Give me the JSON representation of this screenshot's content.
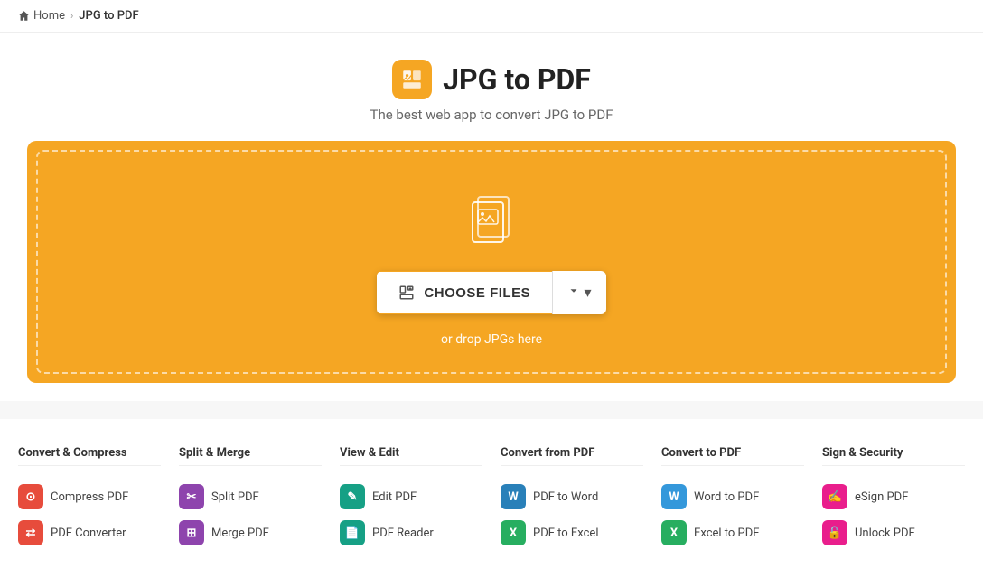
{
  "breadcrumb": {
    "home_label": "Home",
    "separator": "›",
    "current": "JPG to PDF"
  },
  "hero": {
    "title": "JPG to PDF",
    "subtitle": "The best web app to convert JPG to PDF",
    "logo_alt": "jpg-to-pdf-logo"
  },
  "dropzone": {
    "button_label": "CHOOSE FILES",
    "drop_text": "or drop JPGs here"
  },
  "tools": {
    "columns": [
      {
        "title": "Convert & Compress",
        "items": [
          {
            "label": "Compress PDF",
            "icon_color": "icon-red",
            "icon_symbol": "⊙"
          },
          {
            "label": "PDF Converter",
            "icon_color": "icon-red",
            "icon_symbol": "⇄"
          }
        ]
      },
      {
        "title": "Split & Merge",
        "items": [
          {
            "label": "Split PDF",
            "icon_color": "icon-purple",
            "icon_symbol": "✂"
          },
          {
            "label": "Merge PDF",
            "icon_color": "icon-purple",
            "icon_symbol": "⊞"
          }
        ]
      },
      {
        "title": "View & Edit",
        "items": [
          {
            "label": "Edit PDF",
            "icon_color": "icon-teal",
            "icon_symbol": "✎"
          },
          {
            "label": "PDF Reader",
            "icon_color": "icon-teal",
            "icon_symbol": "📄"
          }
        ]
      },
      {
        "title": "Convert from PDF",
        "items": [
          {
            "label": "PDF to Word",
            "icon_color": "icon-blue",
            "icon_symbol": "W"
          },
          {
            "label": "PDF to Excel",
            "icon_color": "icon-green",
            "icon_symbol": "X"
          }
        ]
      },
      {
        "title": "Convert to PDF",
        "items": [
          {
            "label": "Word to PDF",
            "icon_color": "icon-light-blue",
            "icon_symbol": "W"
          },
          {
            "label": "Excel to PDF",
            "icon_color": "icon-green",
            "icon_symbol": "X"
          }
        ]
      },
      {
        "title": "Sign & Security",
        "items": [
          {
            "label": "eSign PDF",
            "icon_color": "icon-pink",
            "icon_symbol": "✍"
          },
          {
            "label": "Unlock PDF",
            "icon_color": "icon-pink",
            "icon_symbol": "🔓"
          }
        ]
      }
    ]
  }
}
